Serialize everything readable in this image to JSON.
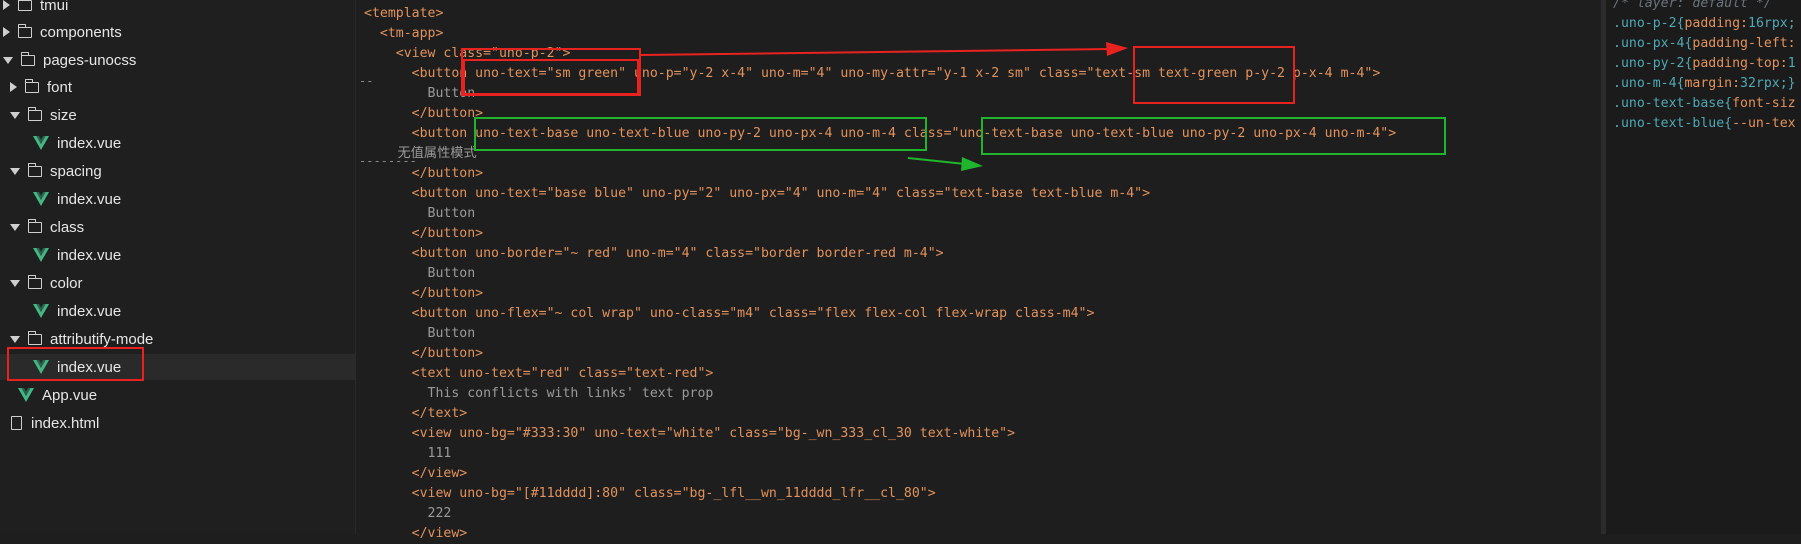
{
  "sidebar": {
    "items": [
      {
        "label": "tmui",
        "type": "folder",
        "state": "collapsed"
      },
      {
        "label": "components",
        "type": "folder",
        "state": "collapsed"
      },
      {
        "label": "pages-unocss",
        "type": "folder",
        "state": "expanded"
      },
      {
        "label": "font",
        "type": "folder",
        "state": "collapsed"
      },
      {
        "label": "size",
        "type": "folder",
        "state": "expanded"
      },
      {
        "label": "index.vue",
        "type": "vue-file"
      },
      {
        "label": "spacing",
        "type": "folder",
        "state": "expanded"
      },
      {
        "label": "index.vue",
        "type": "vue-file"
      },
      {
        "label": "class",
        "type": "folder",
        "state": "expanded"
      },
      {
        "label": "index.vue",
        "type": "vue-file"
      },
      {
        "label": "color",
        "type": "folder",
        "state": "expanded"
      },
      {
        "label": "index.vue",
        "type": "vue-file"
      },
      {
        "label": "attributify-mode",
        "type": "folder",
        "state": "expanded"
      },
      {
        "label": "index.vue",
        "type": "vue-file",
        "selected": true
      },
      {
        "label": "App.vue",
        "type": "vue-file"
      },
      {
        "label": "index.html",
        "type": "file"
      }
    ]
  },
  "editor": {
    "gutter_marks": [
      "--",
      "--------"
    ],
    "lines": [
      "<template>",
      "  <tm-app>",
      "    <view class=\"uno-p-2\">",
      "      <button uno-text=\"sm green\" uno-p=\"y-2 x-4\" uno-m=\"4\" uno-my-attr=\"y-1 x-2 sm\" class=\"text-sm text-green p-y-2 p-x-4 m-4\">",
      "        Button",
      "      </button>",
      "      <button uno-text-base uno-text-blue uno-py-2 uno-px-4 uno-m-4 class=\"uno-text-base uno-text-blue uno-py-2 uno-px-4 uno-m-4\">",
      "        无值属性模式",
      "      </button>",
      "      <button uno-text=\"base blue\" uno-py=\"2\" uno-px=\"4\" uno-m=\"4\" class=\"text-base text-blue m-4\">",
      "        Button",
      "      </button>",
      "      <button uno-border=\"~ red\" uno-m=\"4\" class=\"border border-red m-4\">",
      "        Button",
      "      </button>",
      "      <button uno-flex=\"~ col wrap\" uno-class=\"m4\" class=\"flex flex-col flex-wrap class-m4\">",
      "        Button",
      "      </button>",
      "      <text uno-text=\"red\" class=\"text-red\">",
      "        This conflicts with links' text prop",
      "      </text>",
      "      <view uno-bg=\"#333:30\" uno-text=\"white\" class=\"bg-_wn_333_cl_30 text-white\">",
      "        111",
      "      </view>",
      "      <view uno-bg=\"[#11dddd]:80\" class=\"bg-_lfl__wn_11dddd_lfr__cl_80\">",
      "        222",
      "      </view>"
    ]
  },
  "css_panel": {
    "lines": [
      {
        "selector": "/* layer: default */",
        "prop": "",
        "value": ""
      },
      {
        "selector": ".uno-p-2{",
        "prop": "padding:",
        "value": "16rpx;"
      },
      {
        "selector": ".uno-px-4{",
        "prop": "padding-left:",
        "value": ""
      },
      {
        "selector": ".uno-py-2{",
        "prop": "padding-top:",
        "value": "1"
      },
      {
        "selector": ".uno-m-4{",
        "prop": "margin:",
        "value": "32rpx;}"
      },
      {
        "selector": ".uno-text-base{",
        "prop": "font-siz",
        "value": ""
      },
      {
        "selector": ".uno-text-blue{",
        "prop": "--un-tex",
        "value": ""
      }
    ]
  },
  "colors": {
    "annotation_red": "#e8231f",
    "annotation_green": "#1fb52c",
    "code_orange": "#e2925c"
  }
}
